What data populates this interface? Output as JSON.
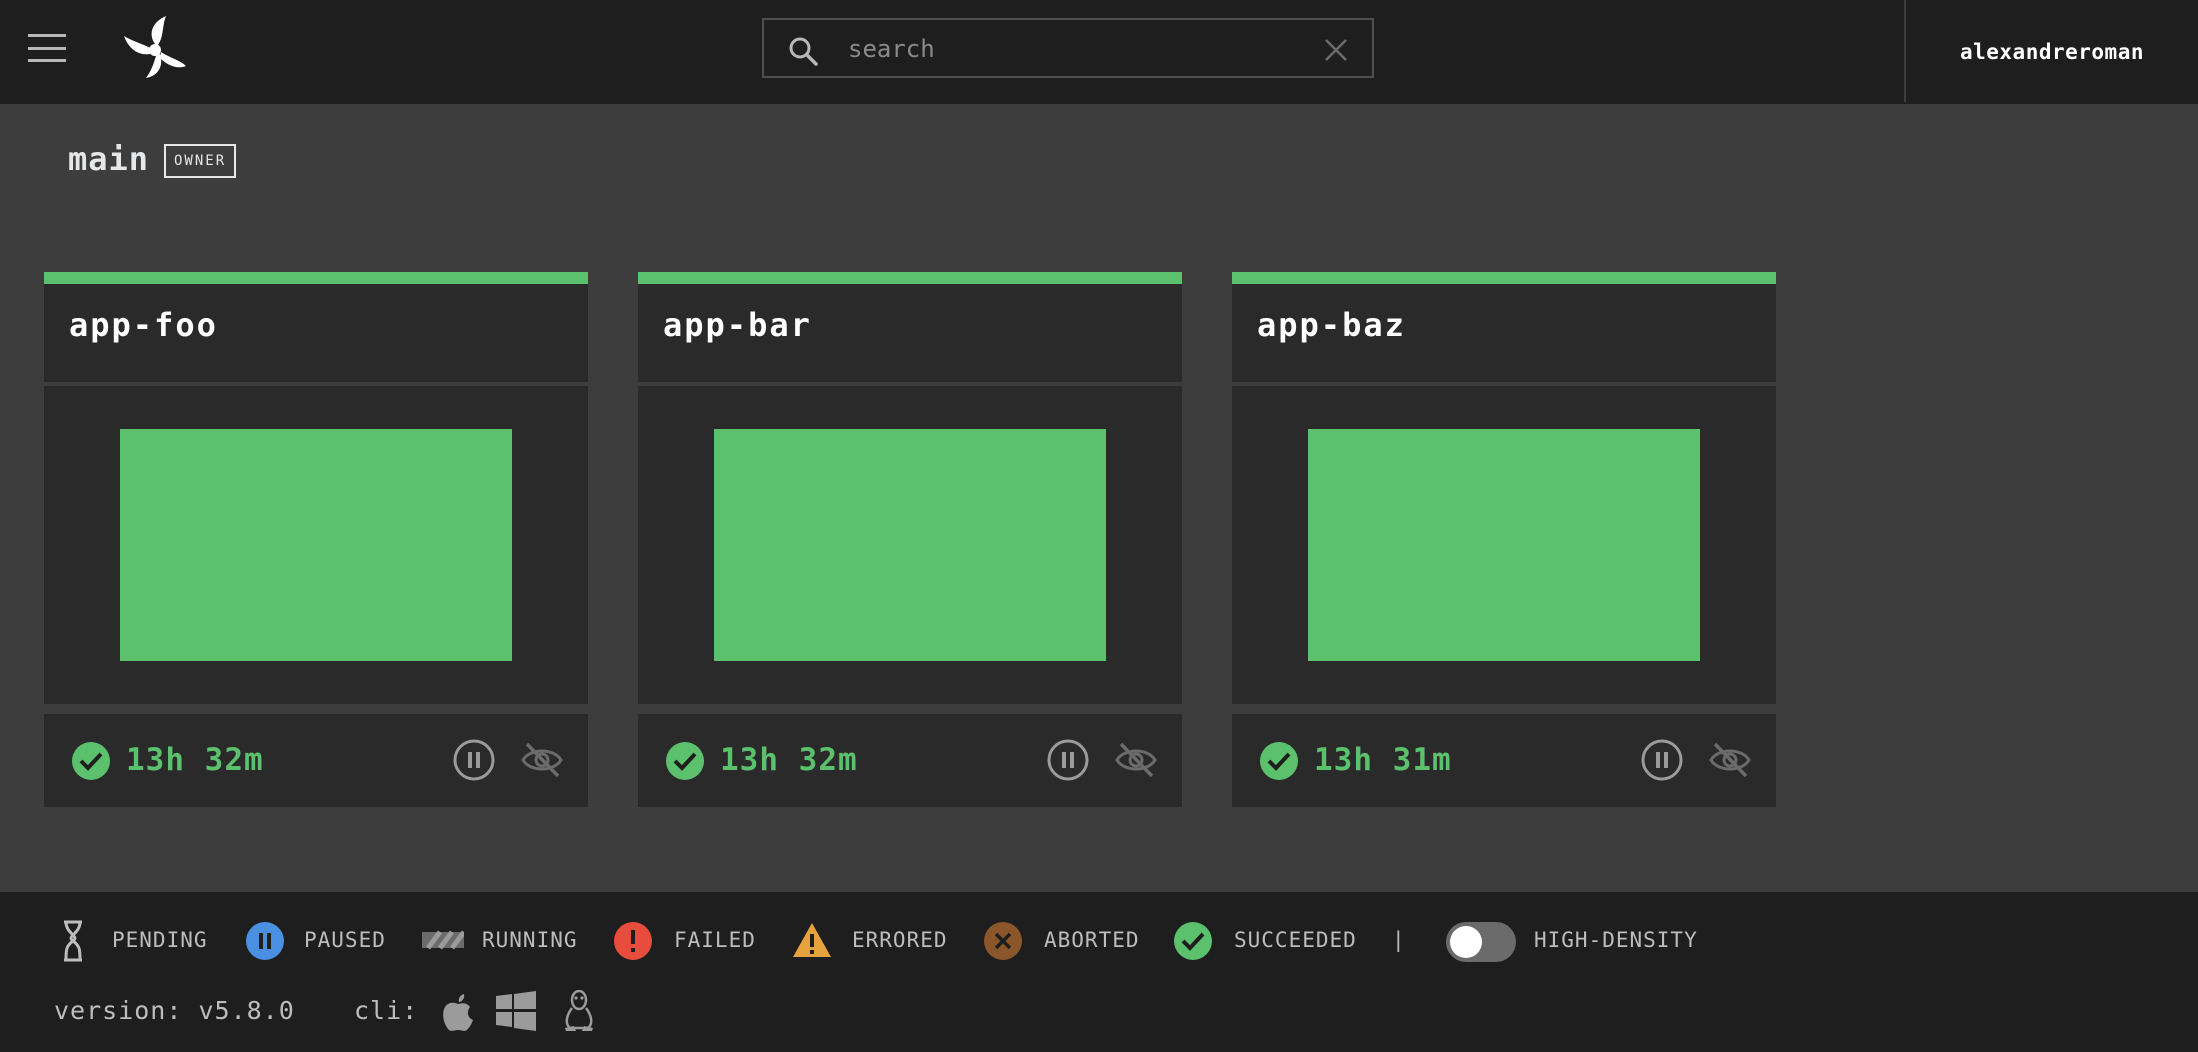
{
  "header": {
    "menu_icon": "hamburger-menu-icon",
    "logo_icon": "concourse-propeller-logo-icon",
    "search": {
      "placeholder": "search",
      "value": "",
      "icon": "search-icon",
      "clear_icon": "close-icon"
    },
    "username": "alexandreroman"
  },
  "team": {
    "name": "main",
    "role_badge": "OWNER"
  },
  "pipelines": [
    {
      "name": "app-foo",
      "status": "succeeded",
      "duration": "13h 32m"
    },
    {
      "name": "app-bar",
      "status": "succeeded",
      "duration": "13h 32m"
    },
    {
      "name": "app-baz",
      "status": "succeeded",
      "duration": "13h 31m"
    }
  ],
  "legend": {
    "pending": "PENDING",
    "paused": "PAUSED",
    "running": "RUNNING",
    "failed": "FAILED",
    "errored": "ERRORED",
    "aborted": "ABORTED",
    "succeeded": "SUCCEEDED",
    "separator": "|",
    "high_density": "HIGH-DENSITY"
  },
  "footer": {
    "version": "version: v5.8.0",
    "cli_label": "cli:",
    "cli_icons": [
      "apple-icon",
      "windows-icon",
      "linux-tux-icon"
    ]
  },
  "colors": {
    "succeeded": "#5bc16d",
    "paused": "#4a90e2",
    "failed": "#e74c3c",
    "errored": "#e6a23c",
    "aborted": "#8b572a",
    "topbar_bg": "#1e1e1e",
    "page_bg": "#3d3d3d",
    "card_bg": "#2a2a2a"
  }
}
